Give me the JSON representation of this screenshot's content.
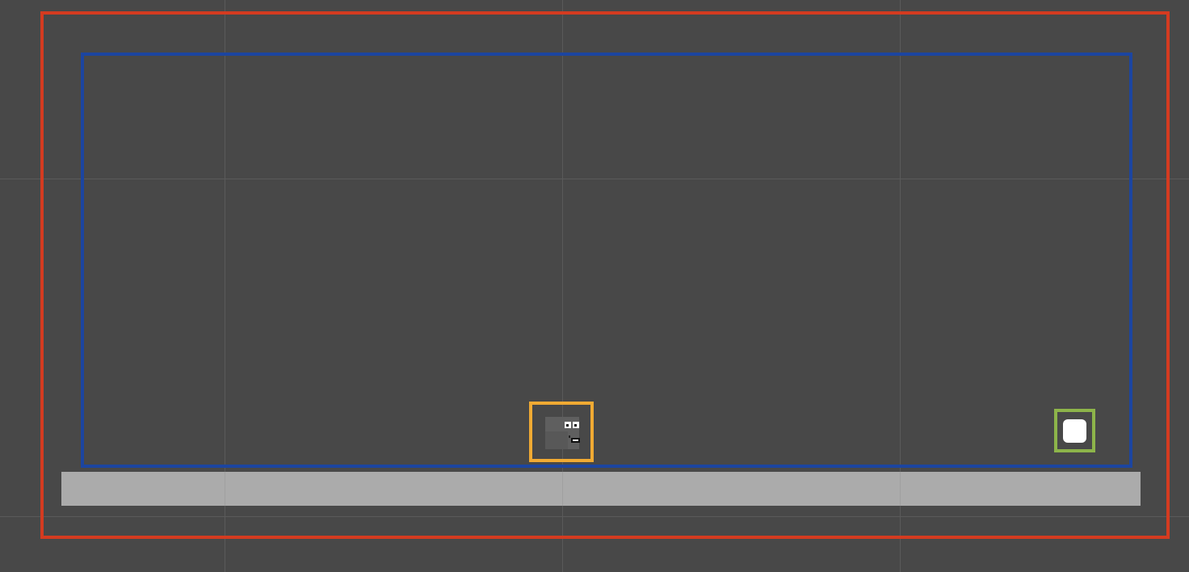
{
  "scene": {
    "background_color": "#484848",
    "grid_color": "#5a5a5a",
    "camera_bounds_color": "#d43b20",
    "play_area_color": "#1c45a0",
    "ground_color": "#ababab",
    "player_highlight_color": "#f0aa33",
    "pickup_highlight_color": "#8db44a",
    "player_icon": "square-character-face",
    "pickup_icon": "white-rounded-square"
  }
}
